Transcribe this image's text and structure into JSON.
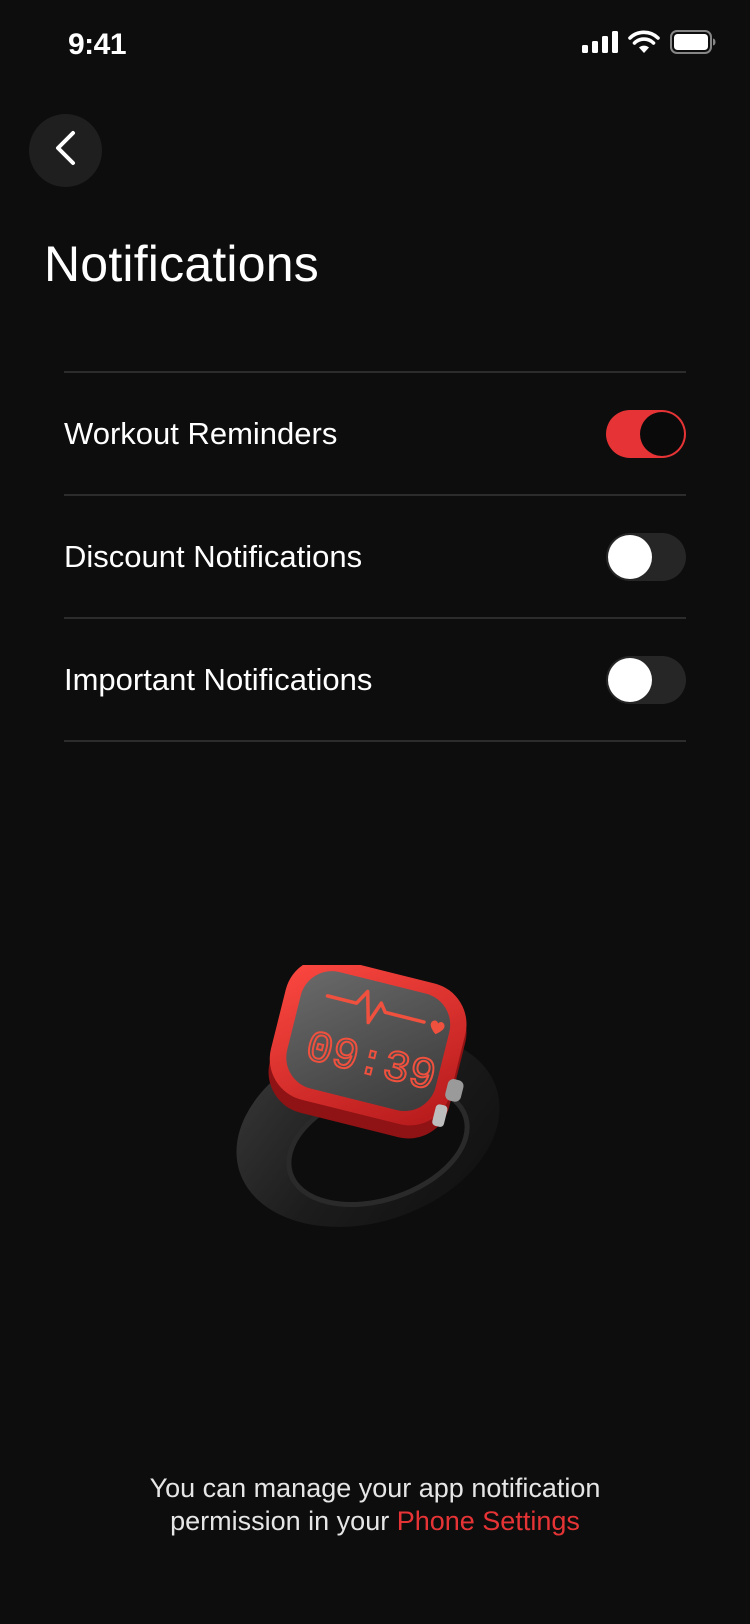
{
  "status_bar": {
    "time": "9:41",
    "icons": [
      "cellular-signal-icon",
      "wifi-icon",
      "battery-icon"
    ]
  },
  "header": {
    "back_icon": "chevron-left-icon",
    "title": "Notifications"
  },
  "settings": {
    "items": [
      {
        "label": "Workout Reminders",
        "enabled": true
      },
      {
        "label": "Discount Notifications",
        "enabled": false
      },
      {
        "label": "Important Notifications",
        "enabled": false
      }
    ]
  },
  "illustration": {
    "name": "smartwatch-illustration",
    "screen_text": "09:39"
  },
  "footer": {
    "line1": "You can manage your app notification",
    "line2_prefix": "permission in your",
    "link_label": "Phone Settings"
  },
  "colors": {
    "background": "#0d0d0d",
    "accent": "#e63436",
    "divider": "#2c2c2c",
    "toggle_off_track": "#262626"
  }
}
